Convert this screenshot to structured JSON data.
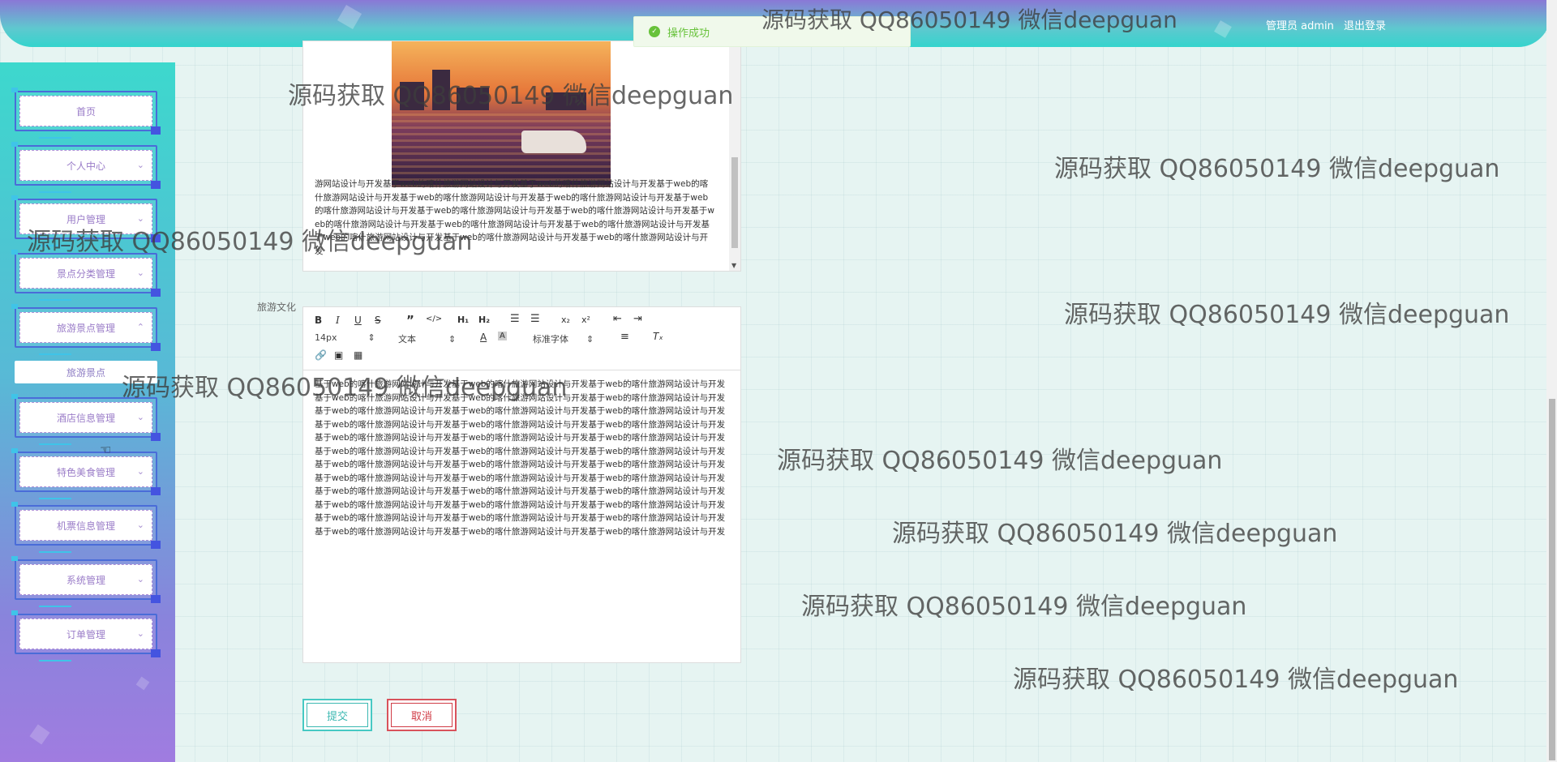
{
  "header": {
    "admin_text": "管理员 admin",
    "logout_label": "退出登录"
  },
  "toast": {
    "message": "操作成功",
    "status_color": "#67c23a",
    "icon": "check-circle-icon"
  },
  "sidebar": {
    "items": [
      {
        "label": "首页",
        "has_arrow": false
      },
      {
        "label": "个人中心",
        "has_arrow": true
      },
      {
        "label": "用户管理",
        "has_arrow": true
      },
      {
        "label": "景点分类管理",
        "has_arrow": true
      },
      {
        "label": "旅游景点管理",
        "has_arrow": true,
        "expanded": true
      },
      {
        "label": "酒店信息管理",
        "has_arrow": true
      },
      {
        "label": "特色美食管理",
        "has_arrow": true
      },
      {
        "label": "机票信息管理",
        "has_arrow": true
      },
      {
        "label": "系统管理",
        "has_arrow": true
      },
      {
        "label": "订单管理",
        "has_arrow": true
      }
    ],
    "sub_item": "旅游景点"
  },
  "editor1": {
    "text": "游网站设计与开发基于web的喀什旅游网站设计与开发基于web的喀什旅游网站设计与开发基于web的喀什旅游网站设计与开发基于web的喀什旅游网站设计与开发基于web的喀什旅游网站设计与开发基于web的喀什旅游网站设计与开发基于web的喀什旅游网站设计与开发基于web的喀什旅游网站设计与开发基于web的喀什旅游网站设计与开发基于web的喀什旅游网站设计与开发基于web的喀什旅游网站设计与开发基于web的喀什旅游网站设计与开发基于web的喀什旅游网站设计与开发基于web的喀什旅游网站设计与开发"
  },
  "form": {
    "culture_label": "旅游文化",
    "submit_label": "提交",
    "cancel_label": "取消"
  },
  "editor2": {
    "toolbar": {
      "font_size": "14px",
      "text_style": "文本",
      "font_family": "标准字体"
    },
    "text": "基于web的喀什旅游网站设计与开发基于web的喀什旅游网站设计与开发基于web的喀什旅游网站设计与开发基于web的喀什旅游网站设计与开发基于web的喀什旅游网站设计与开发基于web的喀什旅游网站设计与开发基于web的喀什旅游网站设计与开发基于web的喀什旅游网站设计与开发基于web的喀什旅游网站设计与开发基于web的喀什旅游网站设计与开发基于web的喀什旅游网站设计与开发基于web的喀什旅游网站设计与开发基于web的喀什旅游网站设计与开发基于web的喀什旅游网站设计与开发基于web的喀什旅游网站设计与开发基于web的喀什旅游网站设计与开发基于web的喀什旅游网站设计与开发基于web的喀什旅游网站设计与开发基于web的喀什旅游网站设计与开发基于web的喀什旅游网站设计与开发基于web的喀什旅游网站设计与开发基于web的喀什旅游网站设计与开发基于web的喀什旅游网站设计与开发基于web的喀什旅游网站设计与开发基于web的喀什旅游网站设计与开发基于web的喀什旅游网站设计与开发基于web的喀什旅游网站设计与开发基于web的喀什旅游网站设计与开发基于web的喀什旅游网站设计与开发基于web的喀什旅游网站设计与开发基于web的喀什旅游网站设计与开发基于web的喀什旅游网站设计与开发基于web的喀什旅游网站设计与开发基于web的喀什旅游网站设计与开发基于web的喀什旅游网站设计与开发基于web的喀什旅游网站设计与开发"
  },
  "watermark": {
    "text": "源码获取 QQ86050149 微信deepguan"
  },
  "colors": {
    "accent_teal": "#46c9c3",
    "accent_red": "#d9525b",
    "menu_purple": "#9a7cc8"
  }
}
